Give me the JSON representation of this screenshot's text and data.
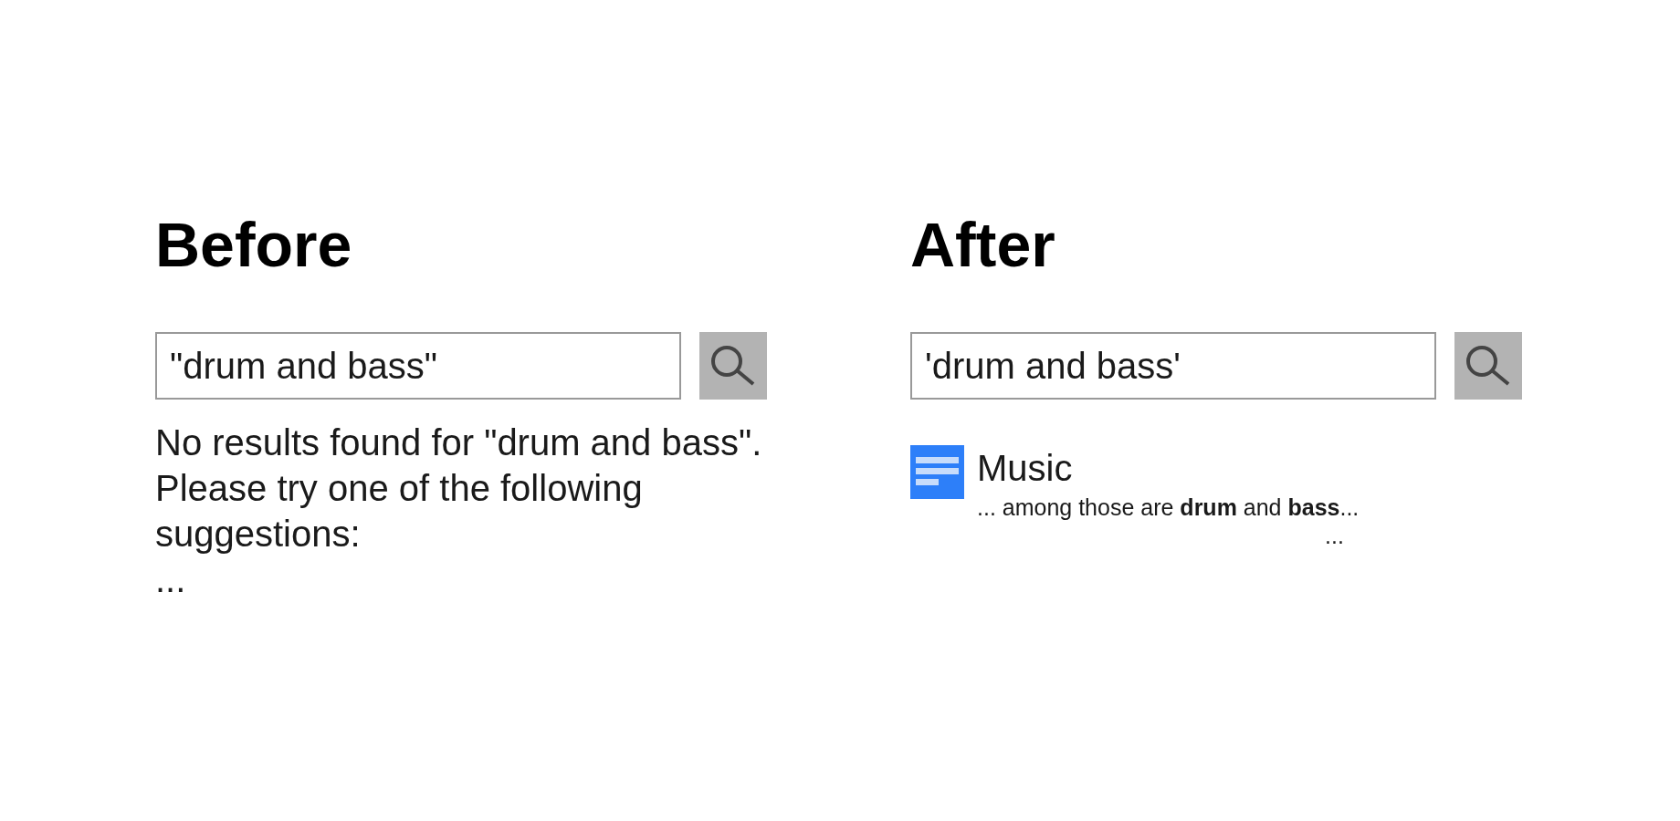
{
  "panels": [
    {
      "title": "Before",
      "search": {
        "value": "\"drum and bass\""
      },
      "message": "No results found for \"drum and bass\". Please try one of the following suggestions:",
      "more": "..."
    },
    {
      "title": "After",
      "search": {
        "value": "'drum and bass'"
      },
      "results": [
        {
          "title": "Music",
          "snippet": "... among those are **drum** and **bass**...",
          "more": "..."
        }
      ]
    }
  ]
}
